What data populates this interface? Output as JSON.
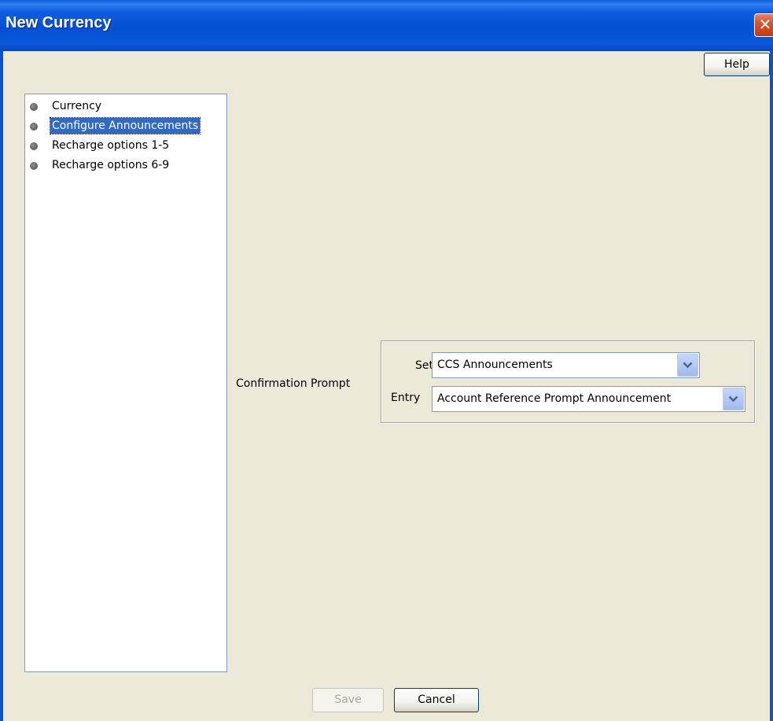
{
  "window": {
    "title": "New Currency",
    "close_icon": "close-icon",
    "close_glyph": "✕"
  },
  "toolbar": {
    "help_label": "Help"
  },
  "nav": {
    "items": [
      {
        "label": "Currency",
        "selected": false
      },
      {
        "label": "Configure Announcements",
        "selected": true
      },
      {
        "label": "Recharge options 1-5",
        "selected": false
      },
      {
        "label": "Recharge options 6-9",
        "selected": false
      }
    ]
  },
  "confirmation": {
    "label": "Confirmation Prompt",
    "set_label": "Set",
    "set_value": "CCS Announcements",
    "entry_label": "Entry",
    "entry_value": "Account Reference Prompt Announcement"
  },
  "footer": {
    "save_label": "Save",
    "save_enabled": false,
    "cancel_label": "Cancel"
  },
  "colors": {
    "titlebar": "#0450d4",
    "selection": "#316ac5",
    "dialog_bg": "#ece9d8"
  }
}
